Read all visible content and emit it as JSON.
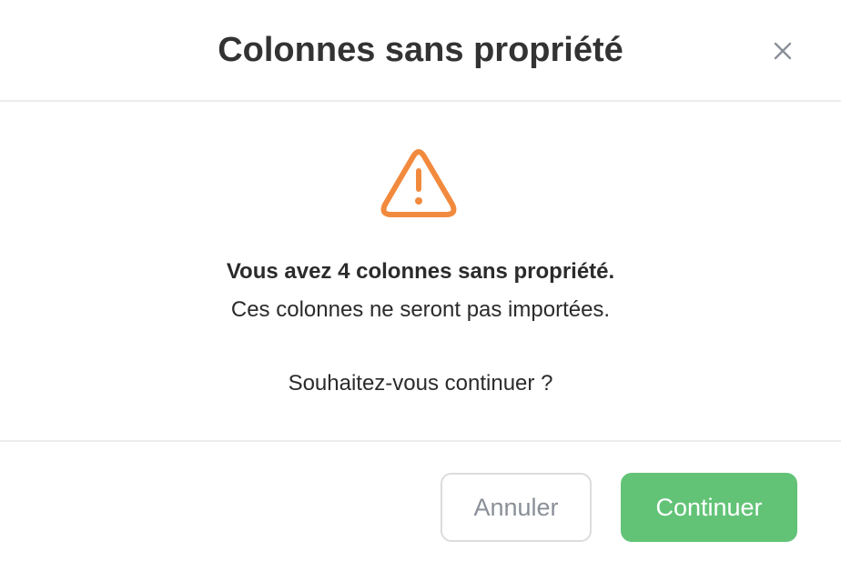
{
  "dialog": {
    "title": "Colonnes sans propriété",
    "close_icon": "close-icon"
  },
  "body": {
    "icon": "warning-triangle-icon",
    "icon_color": "#f28a3e",
    "message_bold": "Vous avez 4 colonnes sans propriété.",
    "message_sub": "Ces colonnes ne seront pas importées.",
    "question": "Souhaitez-vous continuer ?"
  },
  "footer": {
    "cancel_label": "Annuler",
    "continue_label": "Continuer",
    "continue_color": "#62c377"
  }
}
